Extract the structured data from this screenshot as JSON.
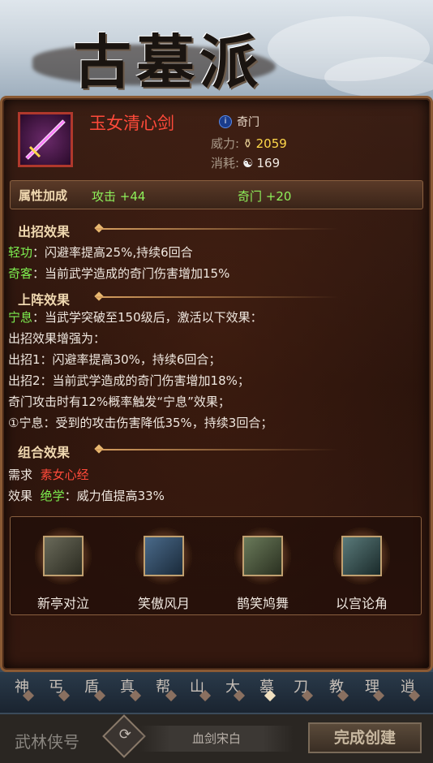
{
  "banner": {
    "sect_name": "古墓派"
  },
  "item": {
    "name": "玉女清心剑",
    "type_icon": "info-icon",
    "type": "奇门",
    "power_label": "威力:",
    "power_value": "2059",
    "cost_label": "消耗:",
    "cost_value": "169"
  },
  "attributes": {
    "title": "属性加成",
    "bonus_1": "攻击 +44",
    "bonus_2": "奇门 +20"
  },
  "attack_effects": {
    "title": "出招效果",
    "lines": [
      {
        "tag": "轻功",
        "text": "：闪避率提高25%,持续6回合"
      },
      {
        "tag": "奇客",
        "text": "：当前武学造成的奇门伤害增加15%"
      }
    ]
  },
  "formation_effects": {
    "title": "上阵效果",
    "tag": "宁息",
    "lines": [
      "：当武学突破至150级后，激活以下效果：",
      "出招效果增强为：",
      "出招1：闪避率提高30%，持续6回合；",
      "出招2：当前武学造成的奇门伤害增加18%；",
      "奇门攻击时有12%概率触发“宁息”效果；",
      "①宁息：受到的攻击伤害降低35%，持续3回合；"
    ]
  },
  "combo_effects": {
    "title": "组合效果",
    "need_label": "需求",
    "need_value": "素女心经",
    "effect_label": "效果",
    "effect_tag": "绝学",
    "effect_text": "：威力值提高33%"
  },
  "skills": [
    {
      "name": "新亭对泣"
    },
    {
      "name": "笑傲风月"
    },
    {
      "name": "鹊笑鸠舞"
    },
    {
      "name": "以宫论角"
    }
  ],
  "sect_strip": [
    "神",
    "丐",
    "盾",
    "真",
    "帮",
    "山",
    "大",
    "墓",
    "刀",
    "教",
    "理",
    "逍"
  ],
  "footer": {
    "title_label": "武林侠号",
    "random_icon": "shuffle-icon",
    "nickname_value": "血剑宋白",
    "done_label": "完成创建"
  },
  "colors": {
    "item_name": "#ff4a3a",
    "bonus": "#8ef05a",
    "power": "#ffd84a"
  }
}
